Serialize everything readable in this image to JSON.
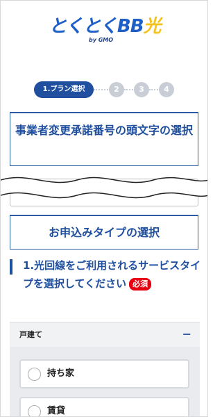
{
  "logo": {
    "text_part1": "とくとく",
    "text_part2": "BB",
    "text_part3": "光",
    "by_text": "by GMO"
  },
  "stepper": {
    "active_label": "1.プラン選択",
    "steps": [
      "2",
      "3",
      "4"
    ]
  },
  "sections": {
    "title1": "事業者変更承諾番号の頭文字の選択",
    "title2": "お申込みタイプの選択"
  },
  "question": {
    "text": "1.光回線をご利用されるサービスタイプを選択してください",
    "required_label": "必須"
  },
  "accordion": {
    "label": "戸建て",
    "toggle_symbol": "−"
  },
  "options": [
    {
      "label": "持ち家"
    },
    {
      "label": "賃貸"
    }
  ],
  "colors": {
    "brand_blue": "#1f4f9e",
    "logo_blue": "#1e5fc7",
    "logo_yellow": "#f4c21a",
    "required_red": "#e60012",
    "step_inactive": "#c9ced6"
  }
}
